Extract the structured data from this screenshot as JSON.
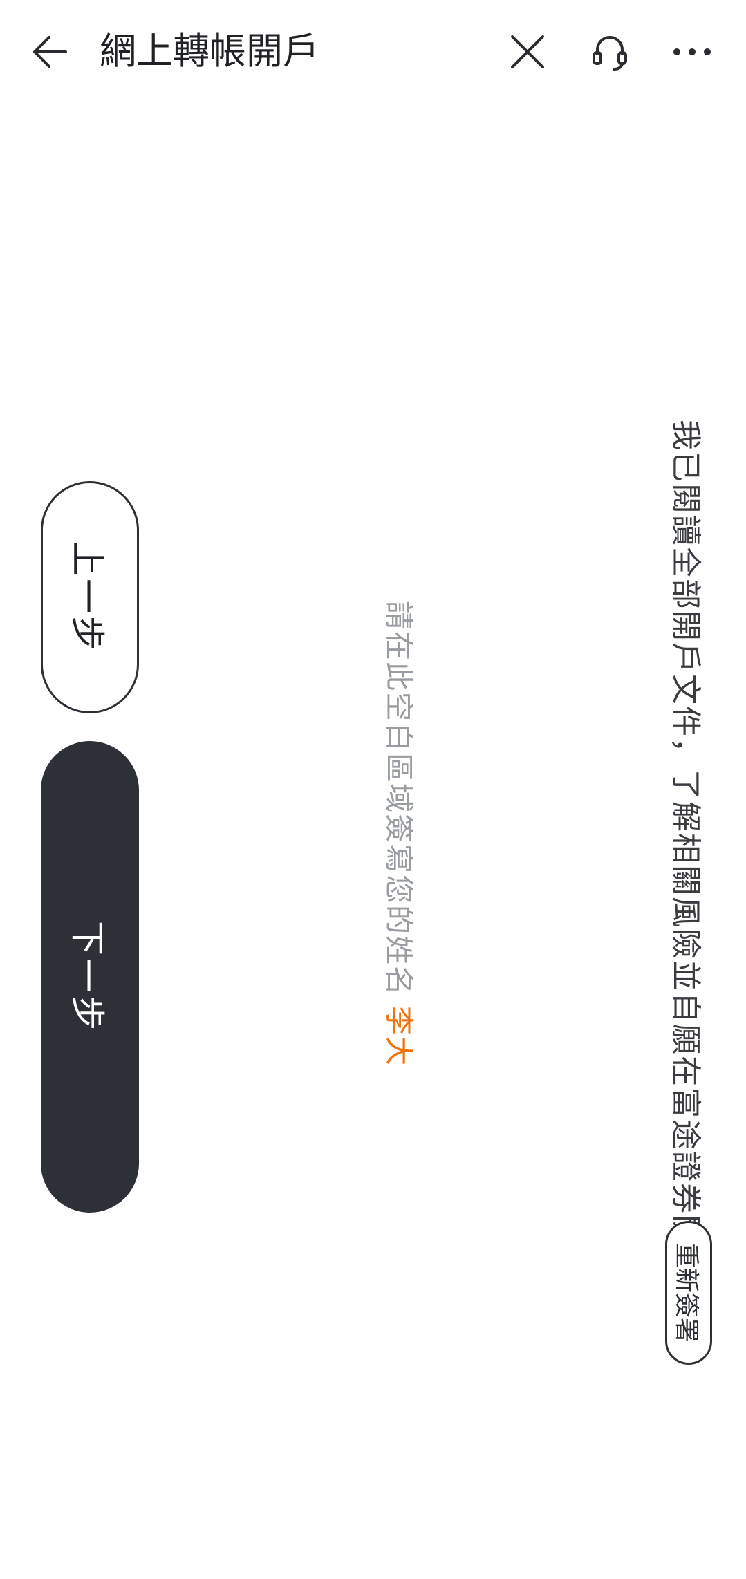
{
  "header": {
    "title": "網上轉帳開戶",
    "back_icon": "arrow-left-icon",
    "close_icon": "close-icon",
    "support_icon": "headset-icon",
    "more_icon": "more-dots-icon"
  },
  "signature": {
    "statement": "我已閱讀全部開戶文件，了解相關風險並自願在富途證券開戶",
    "resign_label": "重新簽署",
    "hint": "請在此空白區域簽寫您的姓名",
    "name": "李大"
  },
  "actions": {
    "prev_label": "上一步",
    "next_label": "下一步"
  },
  "colors": {
    "accent": "#f0720b",
    "primary_button": "#2d3036",
    "hint_text": "#9a9ca3"
  }
}
